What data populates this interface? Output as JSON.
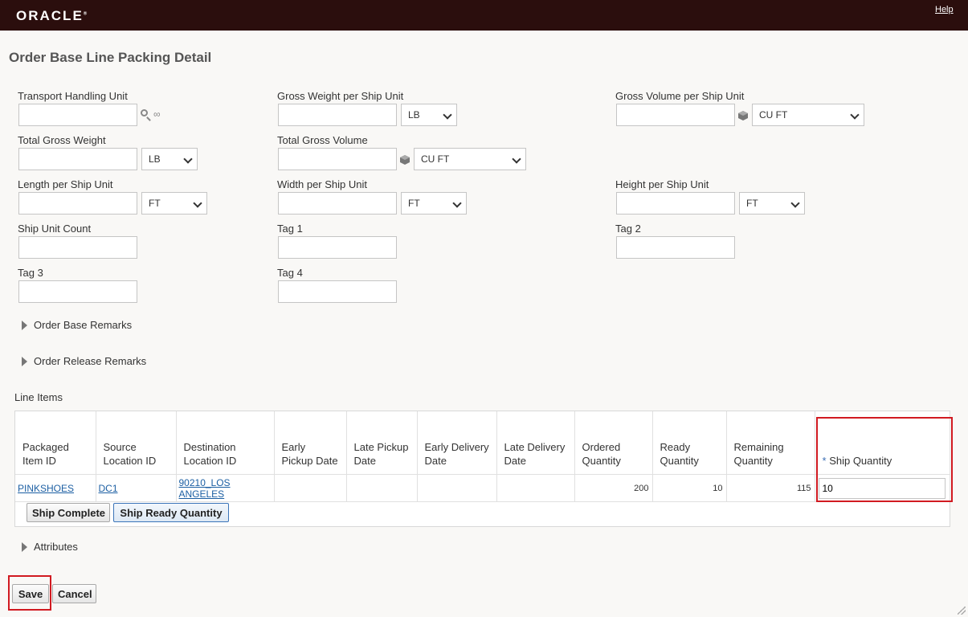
{
  "header": {
    "brand": "ORACLE",
    "help_label": "Help"
  },
  "page": {
    "title": "Order Base Line Packing Detail"
  },
  "fields": {
    "transport_handling_unit": {
      "label": "Transport Handling Unit",
      "value": ""
    },
    "gross_weight_per_ship_unit": {
      "label": "Gross Weight per Ship Unit",
      "value": "",
      "uom": "LB"
    },
    "gross_volume_per_ship_unit": {
      "label": "Gross Volume per Ship Unit",
      "value": "",
      "uom": "CU FT"
    },
    "total_gross_weight": {
      "label": "Total Gross Weight",
      "value": "",
      "uom": "LB"
    },
    "total_gross_volume": {
      "label": "Total Gross Volume",
      "value": "",
      "uom": "CU FT"
    },
    "length_per_ship_unit": {
      "label": "Length per Ship Unit",
      "value": "",
      "uom": "FT"
    },
    "width_per_ship_unit": {
      "label": "Width per Ship Unit",
      "value": "",
      "uom": "FT"
    },
    "height_per_ship_unit": {
      "label": "Height per Ship Unit",
      "value": "",
      "uom": "FT"
    },
    "ship_unit_count": {
      "label": "Ship Unit Count",
      "value": ""
    },
    "tag1": {
      "label": "Tag 1",
      "value": ""
    },
    "tag2": {
      "label": "Tag 2",
      "value": ""
    },
    "tag3": {
      "label": "Tag 3",
      "value": ""
    },
    "tag4": {
      "label": "Tag 4",
      "value": ""
    }
  },
  "sections": {
    "order_base_remarks": "Order Base Remarks",
    "order_release_remarks": "Order Release Remarks",
    "line_items": "Line Items",
    "attributes": "Attributes"
  },
  "line_items": {
    "columns": [
      "Packaged Item ID",
      "Source Location ID",
      "Destination Location ID",
      "Early Pickup Date",
      "Late Pickup Date",
      "Early Delivery Date",
      "Late Delivery Date",
      "Ordered Quantity",
      "Ready Quantity",
      "Remaining Quantity",
      "Ship Quantity"
    ],
    "required_marker": "*",
    "rows": [
      {
        "packaged_item_id": "PINKSHOES",
        "source_location_id": "DC1",
        "destination_location_id": "90210_LOS ANGELES",
        "early_pickup_date": "",
        "late_pickup_date": "",
        "early_delivery_date": "",
        "late_delivery_date": "",
        "ordered_quantity": "200",
        "ready_quantity": "10",
        "remaining_quantity": "115",
        "ship_quantity": "10"
      }
    ],
    "buttons": {
      "ship_complete": "Ship Complete",
      "ship_ready_quantity": "Ship Ready Quantity"
    }
  },
  "footer": {
    "save": "Save",
    "cancel": "Cancel"
  },
  "colors": {
    "header_bg": "#2b0e0d",
    "highlight": "#d11a21",
    "link": "#1c5fa3"
  }
}
